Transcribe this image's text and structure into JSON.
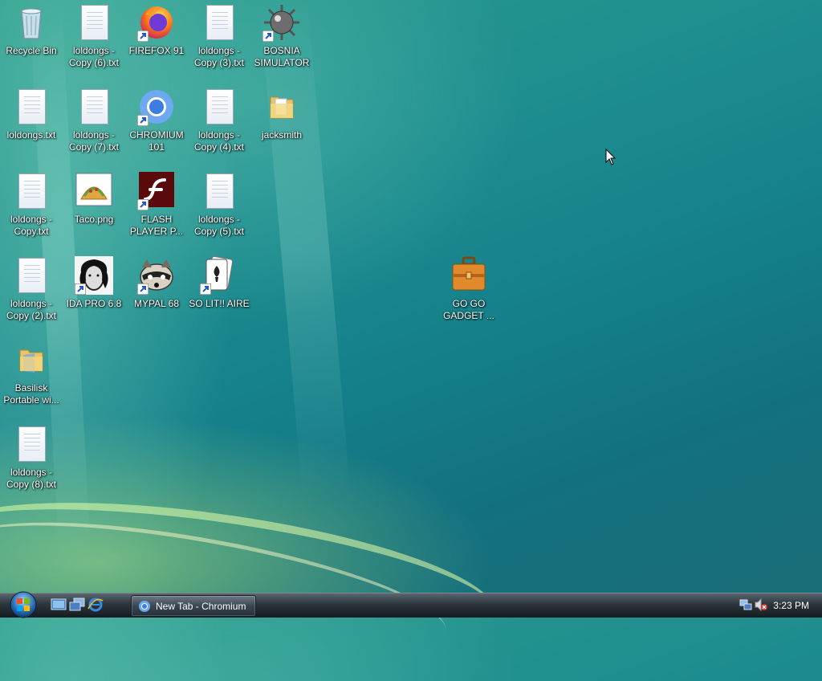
{
  "desktop": {
    "icons": [
      {
        "label": "Recycle Bin"
      },
      {
        "label": "loldongs - Copy (6).txt"
      },
      {
        "label": "FIREFOX 91"
      },
      {
        "label": "loldongs - Copy (3).txt"
      },
      {
        "label": "BOSNIA SIMULATOR"
      },
      {
        "label": "loldongs.txt"
      },
      {
        "label": "loldongs - Copy (7).txt"
      },
      {
        "label": "CHROMIUM 101"
      },
      {
        "label": "loldongs - Copy (4).txt"
      },
      {
        "label": "jacksmith"
      },
      {
        "label": "loldongs - Copy.txt"
      },
      {
        "label": "Taco.png"
      },
      {
        "label": "FLASH PLAYER P..."
      },
      {
        "label": "loldongs - Copy (5).txt"
      },
      {
        "label": "loldongs - Copy (2).txt"
      },
      {
        "label": "IDA PRO 6.8"
      },
      {
        "label": "MYPAL 68"
      },
      {
        "label": "SO LIT!! AIRE"
      },
      {
        "label": "Basilisk Portable wi..."
      },
      {
        "label": "loldongs - Copy (8).txt"
      },
      {
        "label": "GO GO GADGET ..."
      }
    ]
  },
  "taskbar": {
    "task_button_label": "New Tab - Chromium",
    "clock": "3:23 PM"
  }
}
